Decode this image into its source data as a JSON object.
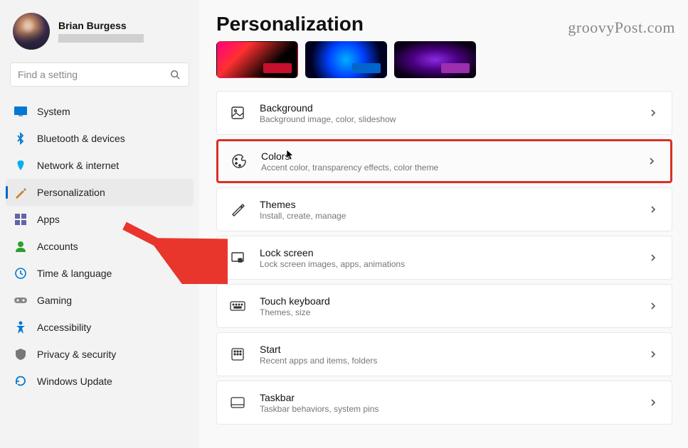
{
  "profile": {
    "name": "Brian Burgess"
  },
  "search": {
    "placeholder": "Find a setting"
  },
  "sidebar": {
    "items": [
      {
        "label": "System",
        "icon": "system"
      },
      {
        "label": "Bluetooth & devices",
        "icon": "bluetooth"
      },
      {
        "label": "Network & internet",
        "icon": "network"
      },
      {
        "label": "Personalization",
        "icon": "personalization",
        "active": true
      },
      {
        "label": "Apps",
        "icon": "apps"
      },
      {
        "label": "Accounts",
        "icon": "accounts"
      },
      {
        "label": "Time & language",
        "icon": "time"
      },
      {
        "label": "Gaming",
        "icon": "gaming"
      },
      {
        "label": "Accessibility",
        "icon": "accessibility"
      },
      {
        "label": "Privacy & security",
        "icon": "privacy"
      },
      {
        "label": "Windows Update",
        "icon": "update"
      }
    ]
  },
  "page": {
    "title": "Personalization"
  },
  "theme_thumbs": [
    {
      "accent": "#c8102e"
    },
    {
      "accent": "#0066cc"
    },
    {
      "accent": "#9b2fae"
    }
  ],
  "settings": [
    {
      "title": "Background",
      "desc": "Background image, color, slideshow",
      "icon": "background"
    },
    {
      "title": "Colors",
      "desc": "Accent color, transparency effects, color theme",
      "icon": "colors",
      "highlighted": true,
      "cursor": true
    },
    {
      "title": "Themes",
      "desc": "Install, create, manage",
      "icon": "themes"
    },
    {
      "title": "Lock screen",
      "desc": "Lock screen images, apps, animations",
      "icon": "lockscreen"
    },
    {
      "title": "Touch keyboard",
      "desc": "Themes, size",
      "icon": "keyboard"
    },
    {
      "title": "Start",
      "desc": "Recent apps and items, folders",
      "icon": "start"
    },
    {
      "title": "Taskbar",
      "desc": "Taskbar behaviors, system pins",
      "icon": "taskbar"
    }
  ],
  "watermark": "groovyPost.com"
}
